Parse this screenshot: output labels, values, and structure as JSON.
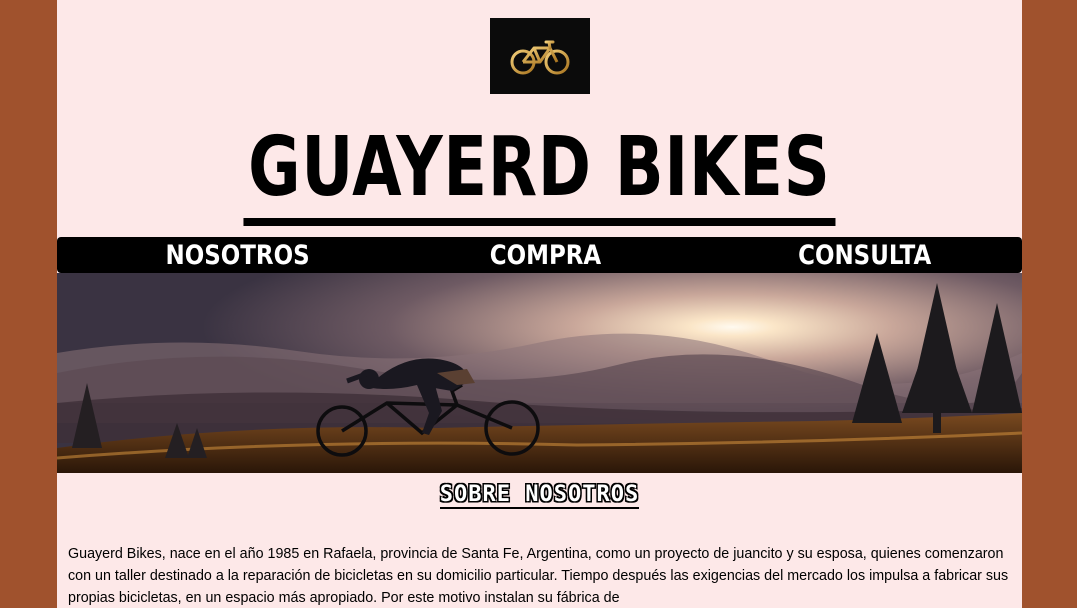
{
  "brand": {
    "logo_icon": "bicycle-icon",
    "title": "GUAYERD BIKES"
  },
  "nav": {
    "items": [
      {
        "label": "NOSOTROS"
      },
      {
        "label": "COMPRA"
      },
      {
        "label": "CONSULTA"
      }
    ]
  },
  "hero": {
    "image_icon": "mountain-biker-sunset-image"
  },
  "about": {
    "heading": "SOBRE NOSOTROS",
    "paragraph": "Guayerd Bikes, nace en el año 1985 en Rafaela, provincia de Santa Fe, Argentina, como un proyecto de juancito y su esposa, quienes comenzaron con un taller destinado a la reparación de bicicletas en su domicilio particular. Tiempo después las exigencias del mercado los impulsa a fabricar sus propias bicicletas, en un espacio más apropiado. Por este motivo instalan su fábrica de"
  },
  "colors": {
    "background": "#a0522d",
    "page": "#fde8e8",
    "nav": "#000000",
    "logo_gold": "#d4a24a"
  }
}
